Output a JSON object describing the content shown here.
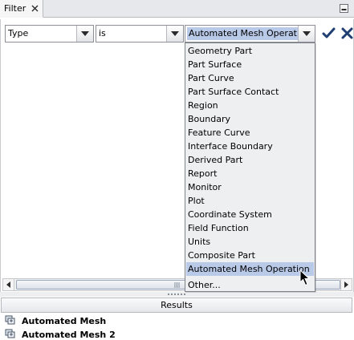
{
  "tab": {
    "title": "Filter"
  },
  "filter": {
    "field": "Type",
    "operator": "is",
    "value": "Automated Mesh Operation"
  },
  "dropdown": {
    "options": [
      "Geometry Part",
      "Part Surface",
      "Part Curve",
      "Part Surface Contact",
      "Region",
      "Boundary",
      "Feature Curve",
      "Interface Boundary",
      "Derived Part",
      "Report",
      "Monitor",
      "Plot",
      "Coordinate System",
      "Field Function",
      "Units",
      "Composite Part",
      "Automated Mesh Operation"
    ],
    "selected": "Automated Mesh Operation",
    "other": "Other..."
  },
  "results": {
    "header": "Results",
    "items": [
      "Automated Mesh",
      "Automated Mesh 2"
    ]
  },
  "icons": {
    "apply": "checkmark-icon",
    "clear": "x-icon",
    "result": "mesh-operation-icon"
  },
  "colors": {
    "selection": "#b9c9e8",
    "apply_check": "#1f3f73",
    "clear_x": "#1f3f73"
  }
}
